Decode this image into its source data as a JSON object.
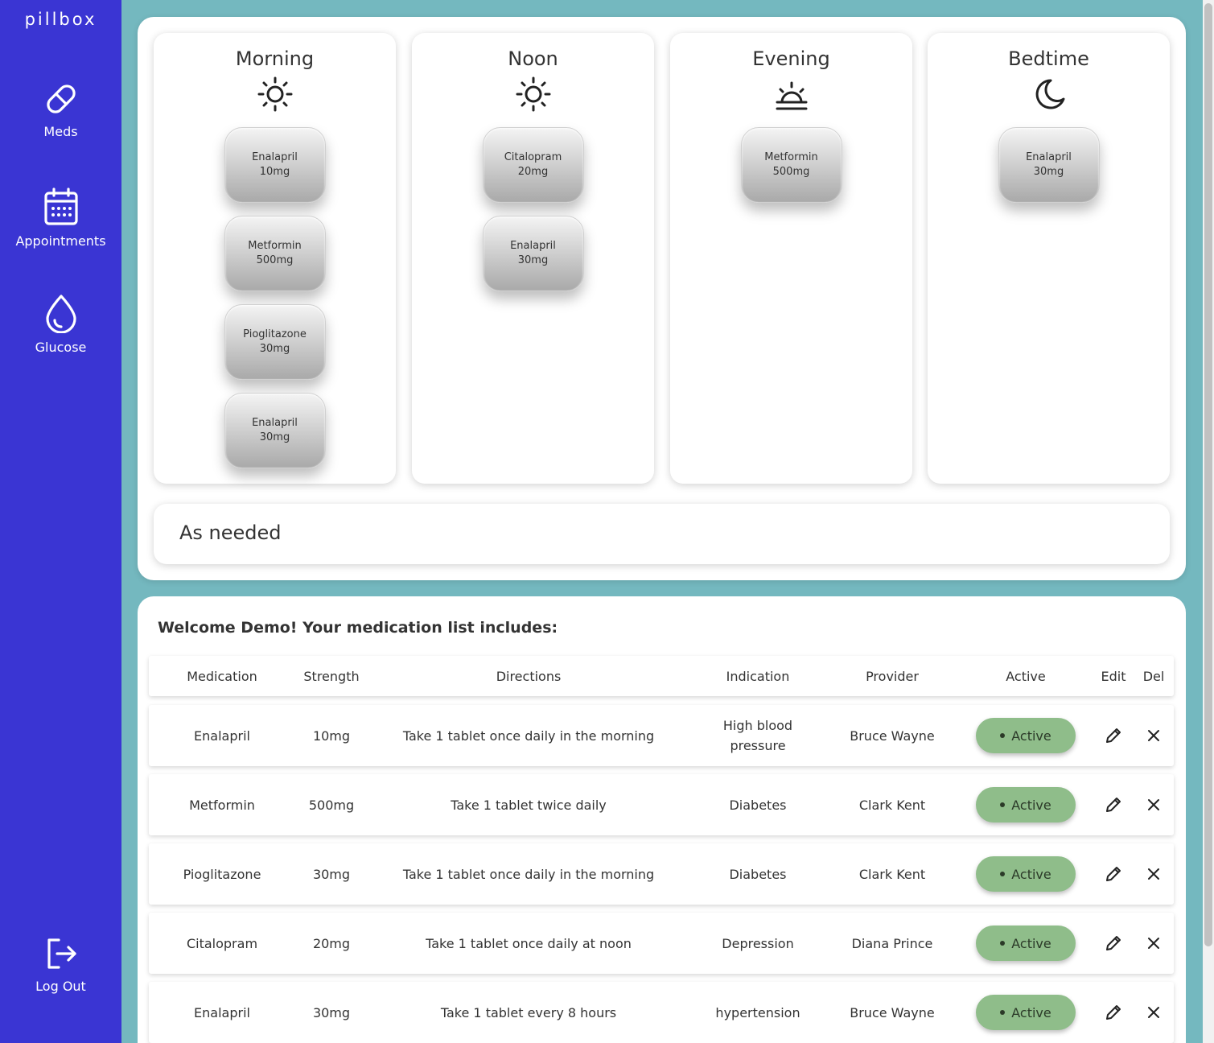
{
  "sidebar": {
    "brand": "pillbox",
    "items": [
      {
        "label": "Meds",
        "icon": "pill-icon"
      },
      {
        "label": "Appointments",
        "icon": "calendar-icon"
      },
      {
        "label": "Glucose",
        "icon": "droplet-icon"
      }
    ],
    "logout": {
      "label": "Log Out",
      "icon": "logout-icon"
    }
  },
  "pillbox": {
    "columns": [
      {
        "title": "Morning",
        "icon": "sun-icon",
        "pills": [
          {
            "name": "Enalapril",
            "strength": "10mg"
          },
          {
            "name": "Metformin",
            "strength": "500mg"
          },
          {
            "name": "Pioglitazone",
            "strength": "30mg"
          },
          {
            "name": "Enalapril",
            "strength": "30mg"
          }
        ]
      },
      {
        "title": "Noon",
        "icon": "sun-icon",
        "pills": [
          {
            "name": "Citalopram",
            "strength": "20mg"
          },
          {
            "name": "Enalapril",
            "strength": "30mg"
          }
        ]
      },
      {
        "title": "Evening",
        "icon": "sunset-icon",
        "pills": [
          {
            "name": "Metformin",
            "strength": "500mg"
          }
        ]
      },
      {
        "title": "Bedtime",
        "icon": "moon-icon",
        "pills": [
          {
            "name": "Enalapril",
            "strength": "30mg"
          }
        ]
      }
    ],
    "as_needed": "As needed"
  },
  "medlist": {
    "welcome": "Welcome Demo! Your medication list includes:",
    "headers": [
      "Medication",
      "Strength",
      "Directions",
      "Indication",
      "Provider",
      "Active",
      "Edit",
      "Del"
    ],
    "rows": [
      [
        "Enalapril",
        "10mg",
        "Take 1 tablet once daily in the morning",
        "High blood pressure",
        "Bruce Wayne",
        "Active"
      ],
      [
        "Metformin",
        "500mg",
        "Take 1 tablet twice daily",
        "Diabetes",
        "Clark Kent",
        "Active"
      ],
      [
        "Pioglitazone",
        "30mg",
        "Take 1 tablet once daily in the morning",
        "Diabetes",
        "Clark Kent",
        "Active"
      ],
      [
        "Citalopram",
        "20mg",
        "Take 1 tablet once daily at noon",
        "Depression",
        "Diana Prince",
        "Active"
      ],
      [
        "Enalapril",
        "30mg",
        "Take 1 tablet every 8 hours",
        "hypertension",
        "Bruce Wayne",
        "Active"
      ]
    ]
  },
  "colors": {
    "sidebar": "#3a35d3",
    "background": "#74b8bf",
    "active_badge": "#8fbd8a"
  }
}
